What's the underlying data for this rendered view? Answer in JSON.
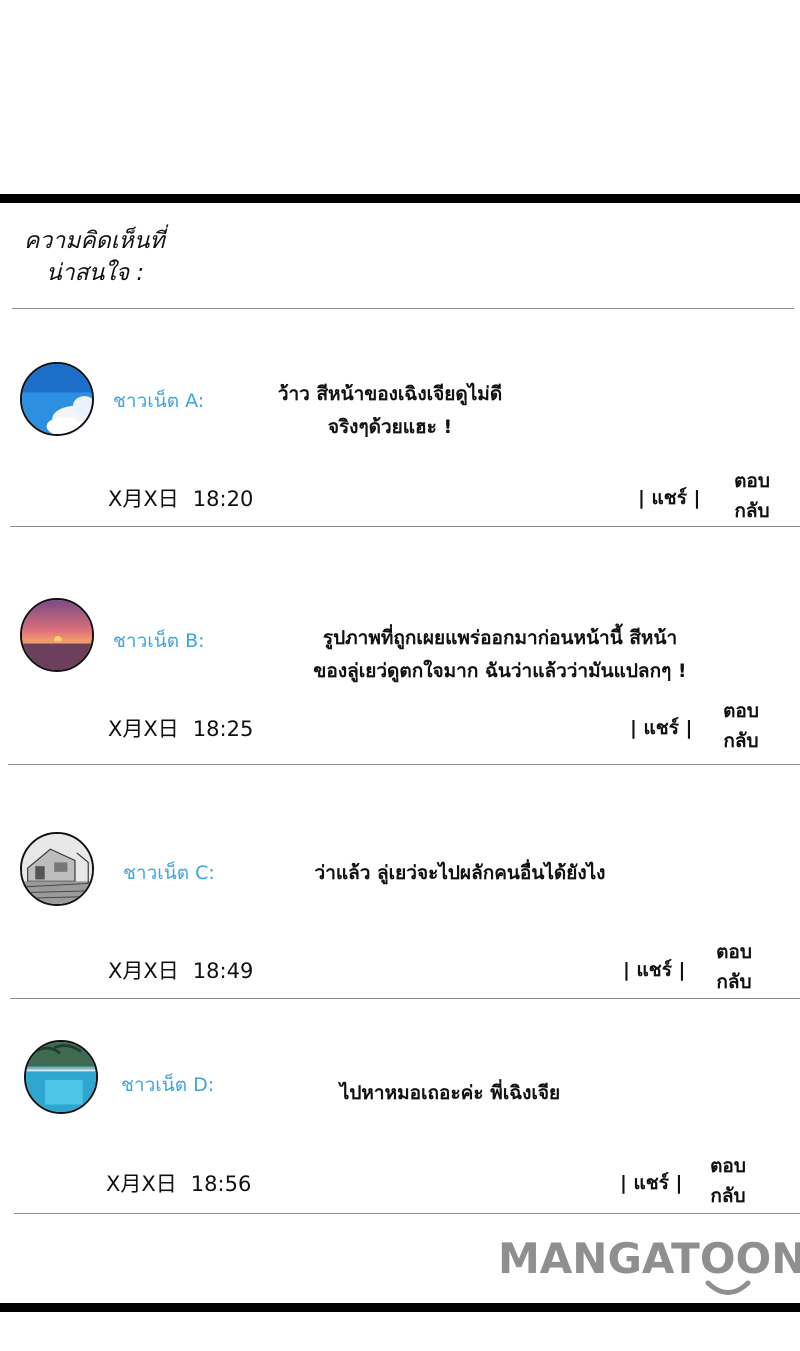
{
  "heading": {
    "line1": "ความคิดเห็นที่",
    "line2": "น่าสนใจ :"
  },
  "comments": [
    {
      "user": "ชาวเน็ต A:",
      "text_line1": "ว้าว สีหน้าของเฉิงเจียดูไม่ดี",
      "text_line2": "จริงๆด้วยแฮะ !",
      "date": "X月X日",
      "time": "18:20",
      "share": "| แชร์ |",
      "reply_line1": "ตอบ",
      "reply_line2": "กลับ",
      "avatar_icon": "sky-clouds-avatar"
    },
    {
      "user": "ชาวเน็ต B:",
      "text_line1": "รูปภาพที่ถูกเผยแพร่ออกมาก่อนหน้านี้ สีหน้า",
      "text_line2": "ของลู่เยว่ดูตกใจมาก ฉันว่าแล้วว่ามันแปลกๆ !",
      "date": "X月X日",
      "time": "18:25",
      "share": "| แชร์ |",
      "reply_line1": "ตอบ",
      "reply_line2": "กลับ",
      "avatar_icon": "sunset-sea-avatar"
    },
    {
      "user": "ชาวเน็ต C:",
      "text_line1": "ว่าแล้ว ลู่เยว่จะไปผลักคนอื่นได้ยังไง",
      "text_line2": "",
      "date": "X月X日",
      "time": "18:49",
      "share": "| แชร์ |",
      "reply_line1": "ตอบ",
      "reply_line2": "กลับ",
      "avatar_icon": "ruined-house-sketch-avatar"
    },
    {
      "user": "ชาวเน็ต D:",
      "text_line1": "ไปหาหมอเถอะค่ะ พี่เฉิงเจีย",
      "text_line2": "",
      "date": "X月X日",
      "time": "18:56",
      "share": "| แชร์ |",
      "reply_line1": "ตอบ",
      "reply_line2": "กลับ",
      "avatar_icon": "pool-palm-avatar"
    }
  ],
  "watermark": "MANGATOON",
  "colors": {
    "username": "#3ea3e0",
    "divider": "#8a8a8a",
    "watermark": "#8f8f8f"
  }
}
